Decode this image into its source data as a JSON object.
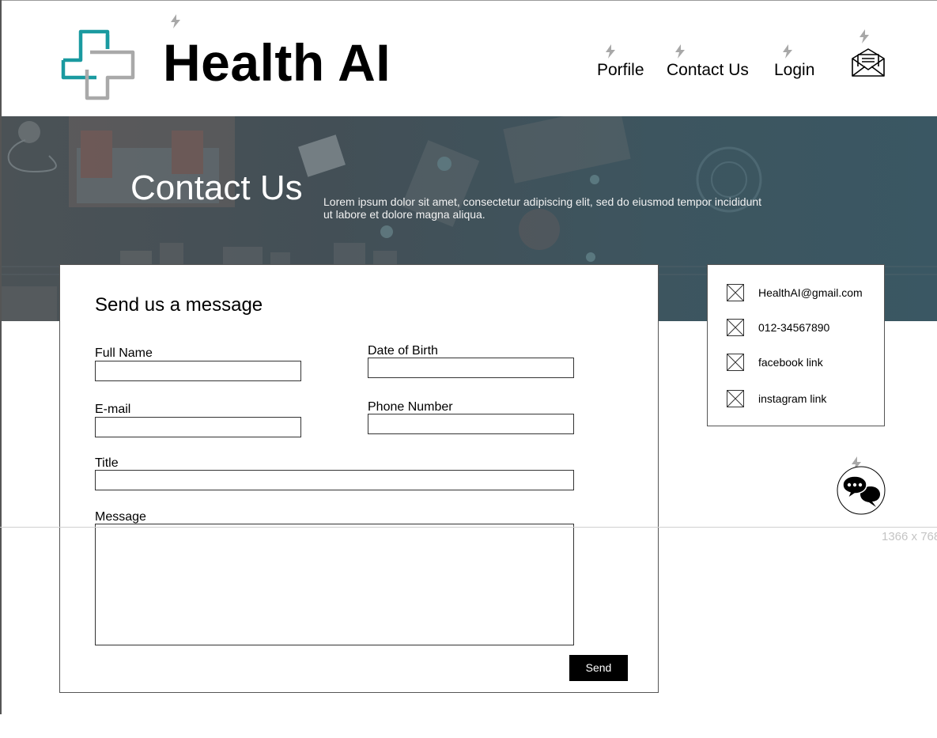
{
  "header": {
    "title": "Health AI",
    "nav": [
      {
        "label": "Porfile"
      },
      {
        "label": "Contact Us"
      },
      {
        "label": "Login"
      }
    ]
  },
  "hero": {
    "title": "Contact Us",
    "description": "Lorem ipsum dolor sit amet, consectetur adipiscing elit, sed do eiusmod tempor incididunt ut labore et dolore magna aliqua."
  },
  "form": {
    "heading": "Send us a message",
    "fields": {
      "full_name": {
        "label": "Full Name",
        "value": ""
      },
      "date_of_birth": {
        "label": "Date of Birth",
        "value": ""
      },
      "email": {
        "label": "E-mail",
        "value": ""
      },
      "phone_number": {
        "label": "Phone Number",
        "value": ""
      },
      "title": {
        "label": "Title",
        "value": ""
      },
      "message": {
        "label": "Message",
        "value": ""
      }
    },
    "send_label": "Send"
  },
  "contact_info": [
    {
      "icon": "image-placeholder-icon",
      "text": "HealthAI@gmail.com"
    },
    {
      "icon": "image-placeholder-icon",
      "text": "012-34567890"
    },
    {
      "icon": "image-placeholder-icon",
      "text": "facebook link"
    },
    {
      "icon": "image-placeholder-icon",
      "text": "instagram link"
    }
  ],
  "canvas_guide": {
    "size_label": "1366 x 768"
  },
  "colors": {
    "logo_teal": "#1a9aa0",
    "logo_gray": "#a9a9a9",
    "hero_overlay": "#3d555f",
    "button": "#000000",
    "bolt_marker": "#a8a8a8"
  }
}
